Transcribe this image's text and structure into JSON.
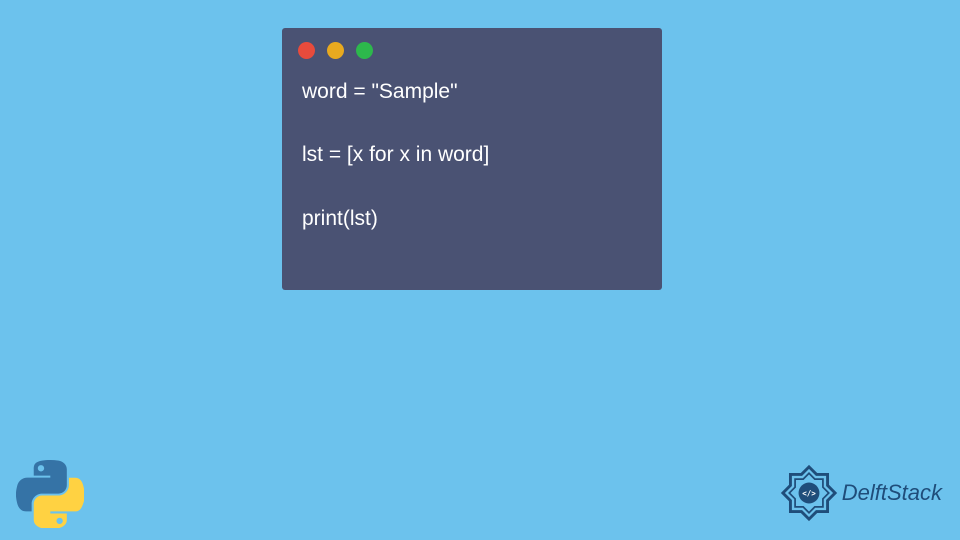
{
  "code": {
    "line1": "word = \"Sample\"",
    "line2": "lst = [x for x in word]",
    "line3": "print(lst)"
  },
  "branding": {
    "name": "DelftStack"
  },
  "colors": {
    "background": "#6cc2ed",
    "codeWindow": "#4a5273",
    "dotRed": "#e84b3c",
    "dotYellow": "#e8a91f",
    "dotGreen": "#2db84c",
    "textWhite": "#ffffff",
    "brandBlue": "#1f4d7a"
  }
}
